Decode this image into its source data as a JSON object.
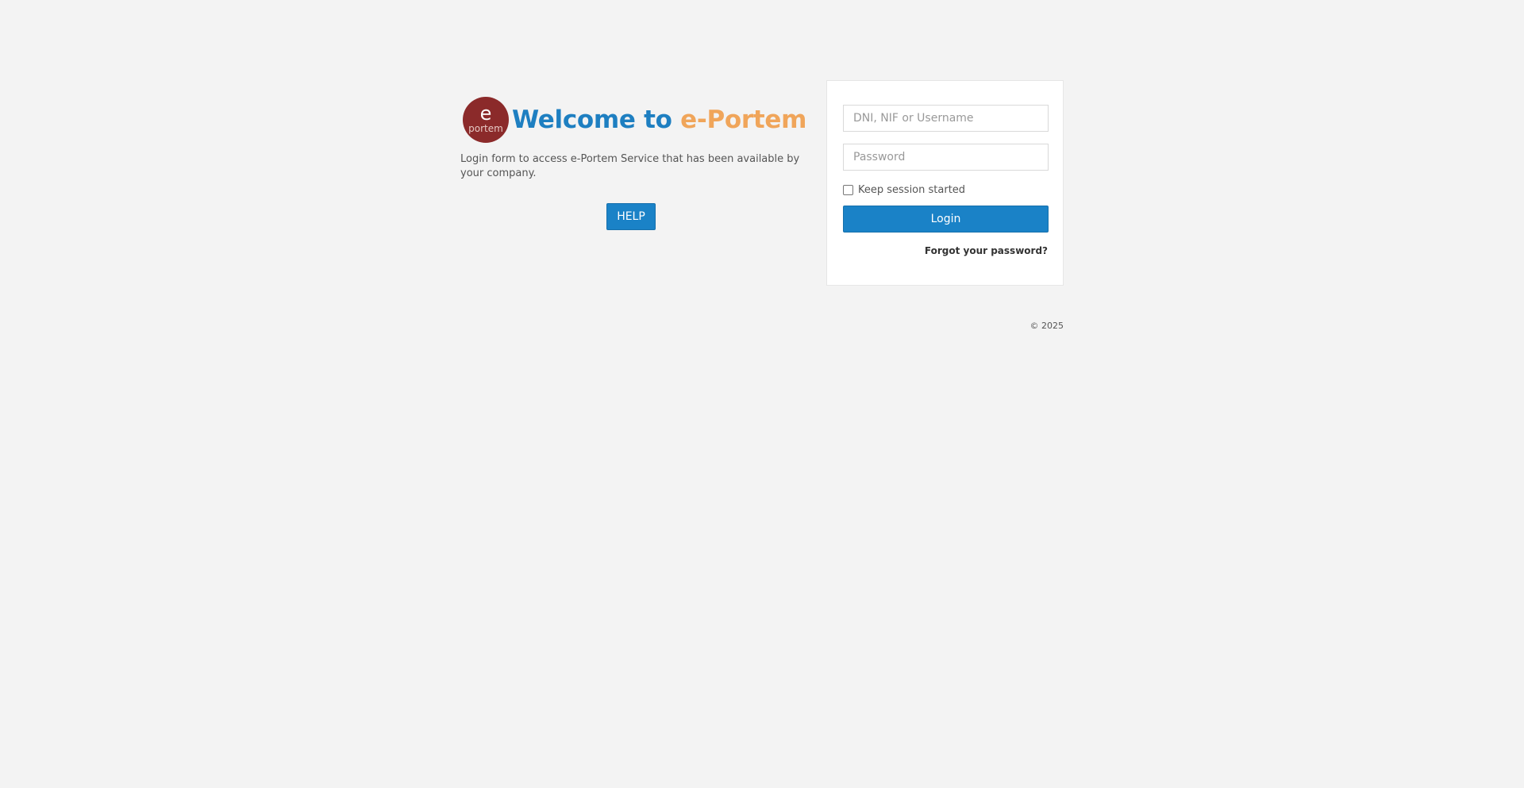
{
  "brand": {
    "logo_letter": "e",
    "logo_word": "portem",
    "welcome_prefix": "Welcome to ",
    "welcome_product": "e-Portem"
  },
  "intro": {
    "description": "Login form to access e-Portem Service that has been available by your company.",
    "help_label": "HELP"
  },
  "login": {
    "username_placeholder": "DNI, NIF or Username",
    "username_value": "",
    "password_placeholder": "Password",
    "password_value": "",
    "remember_label": "Keep session started",
    "remember_checked": false,
    "submit_label": "Login",
    "forgot_label": "Forgot your password?"
  },
  "footer": {
    "copyright": "© 2025"
  },
  "colors": {
    "background": "#f3f3f3",
    "primary": "#1a82c7",
    "accent": "#f0a55a",
    "logo": "#8b2a2a"
  }
}
